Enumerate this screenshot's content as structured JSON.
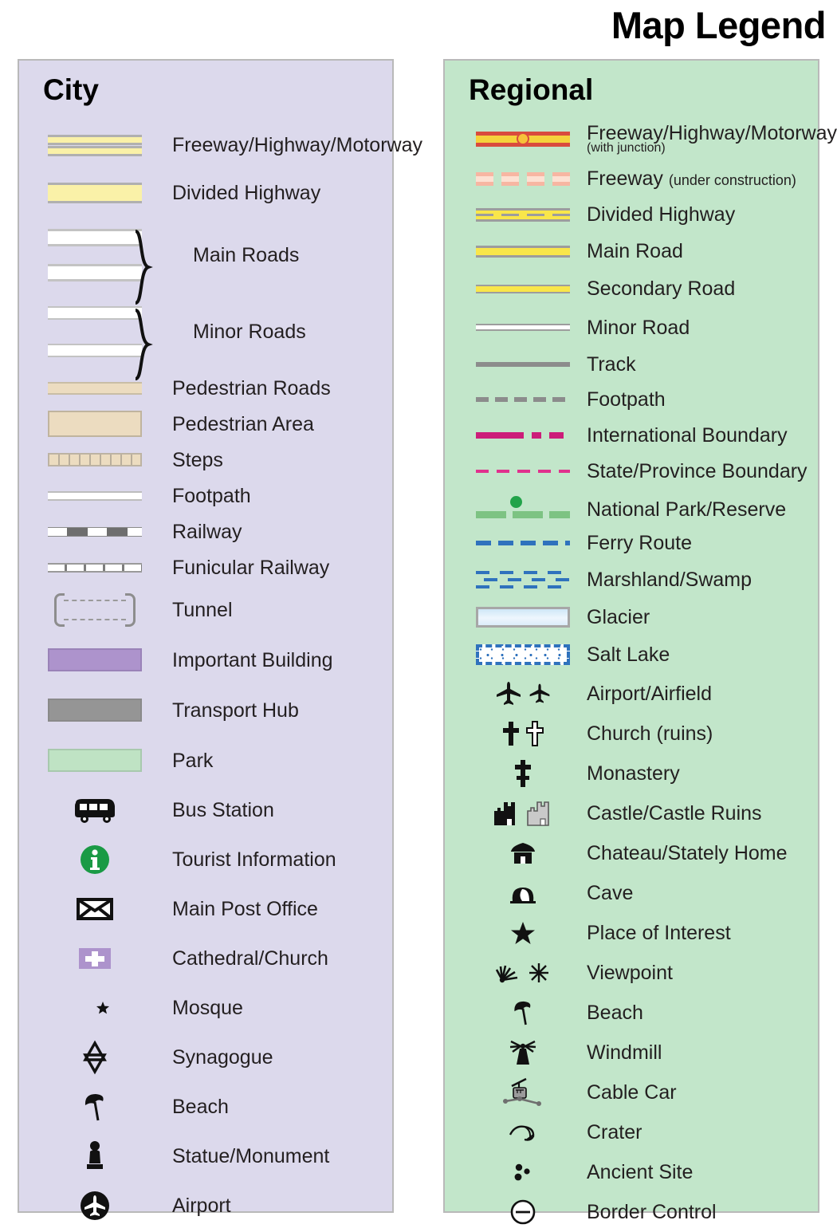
{
  "title": "Map Legend",
  "panels": {
    "city": {
      "heading": "City",
      "bg_color": "#dcd9ec",
      "items": [
        {
          "label": "Freeway/Highway/Motorway",
          "symbol": "freeway-double-band"
        },
        {
          "label": "Divided Highway",
          "symbol": "divided-highway-band"
        },
        {
          "label": "Main Roads",
          "symbol": "main-roads-pair-brace"
        },
        {
          "label": "Minor Roads",
          "symbol": "minor-roads-pair-brace"
        },
        {
          "label": "Pedestrian Roads",
          "symbol": "pedestrian-road-band"
        },
        {
          "label": "Pedestrian Area",
          "symbol": "pedestrian-area-block"
        },
        {
          "label": "Steps",
          "symbol": "steps-hatched-band"
        },
        {
          "label": "Footpath",
          "symbol": "footpath-thin-line"
        },
        {
          "label": "Railway",
          "symbol": "railway-dashed-line"
        },
        {
          "label": "Funicular Railway",
          "symbol": "funicular-ticked-line"
        },
        {
          "label": "Tunnel",
          "symbol": "tunnel-brackets"
        },
        {
          "label": "Important Building",
          "symbol": "important-building-block"
        },
        {
          "label": "Transport Hub",
          "symbol": "transport-hub-block"
        },
        {
          "label": "Park",
          "symbol": "park-block"
        },
        {
          "label": "Bus Station",
          "symbol": "bus-icon"
        },
        {
          "label": "Tourist Information",
          "symbol": "information-icon"
        },
        {
          "label": "Main Post Office",
          "symbol": "envelope-icon"
        },
        {
          "label": "Cathedral/Church",
          "symbol": "church-cross-icon"
        },
        {
          "label": "Mosque",
          "symbol": "crescent-star-icon"
        },
        {
          "label": "Synagogue",
          "symbol": "star-of-david-icon"
        },
        {
          "label": "Beach",
          "symbol": "beach-umbrella-icon"
        },
        {
          "label": "Statue/Monument",
          "symbol": "statue-icon"
        },
        {
          "label": "Airport",
          "symbol": "airport-circle-icon"
        }
      ]
    },
    "regional": {
      "heading": "Regional",
      "bg_color": "#c2e6ca",
      "items": [
        {
          "label": "Freeway/Highway/Motorway",
          "sublabel": "(with junction)",
          "sub_style": "block",
          "symbol": "freeway-junction-line"
        },
        {
          "label": "Freeway",
          "sublabel": "(under construction)",
          "sub_style": "inline",
          "symbol": "freeway-construction-dashes"
        },
        {
          "label": "Divided Highway",
          "symbol": "divided-highway-line"
        },
        {
          "label": "Main Road",
          "symbol": "main-road-line"
        },
        {
          "label": "Secondary Road",
          "symbol": "secondary-road-line"
        },
        {
          "label": "Minor Road",
          "symbol": "minor-road-line"
        },
        {
          "label": "Track",
          "symbol": "track-line"
        },
        {
          "label": "Footpath",
          "symbol": "footpath-dashed-line"
        },
        {
          "label": "International Boundary",
          "symbol": "international-boundary-line"
        },
        {
          "label": "State/Province Boundary",
          "symbol": "state-boundary-line"
        },
        {
          "label": "National Park/Reserve",
          "symbol": "national-park-line"
        },
        {
          "label": "Ferry Route",
          "symbol": "ferry-route-line"
        },
        {
          "label": "Marshland/Swamp",
          "symbol": "marshland-pattern"
        },
        {
          "label": "Glacier",
          "symbol": "glacier-block"
        },
        {
          "label": "Salt Lake",
          "symbol": "salt-lake-block"
        },
        {
          "label": "Airport/Airfield",
          "symbol": "airplane-pair-icon"
        },
        {
          "label": "Church (ruins)",
          "symbol": "cross-pair-icon"
        },
        {
          "label": "Monastery",
          "symbol": "monastery-cross-icon"
        },
        {
          "label": "Castle/Castle Ruins",
          "symbol": "castle-pair-icon"
        },
        {
          "label": "Chateau/Stately Home",
          "symbol": "chateau-icon"
        },
        {
          "label": "Cave",
          "symbol": "cave-icon"
        },
        {
          "label": "Place of Interest",
          "symbol": "star-icon"
        },
        {
          "label": "Viewpoint",
          "symbol": "viewpoint-pair-icon"
        },
        {
          "label": "Beach",
          "symbol": "beach-umbrella-icon"
        },
        {
          "label": "Windmill",
          "symbol": "windmill-icon"
        },
        {
          "label": "Cable Car",
          "symbol": "cable-car-icon"
        },
        {
          "label": "Crater",
          "symbol": "crater-icon"
        },
        {
          "label": "Ancient Site",
          "symbol": "ancient-site-icon"
        },
        {
          "label": "Border Control",
          "symbol": "border-control-icon"
        }
      ]
    }
  },
  "colors": {
    "city_panel_bg": "#dcd9ec",
    "regional_panel_bg": "#c2e6ca",
    "highway_yellow": "#faf1a8",
    "road_yellow": "#f9e64a",
    "freeway_red": "#d94b3e",
    "pedestrian_tan": "#ecdcc0",
    "important_building_purple": "#ad93cc",
    "transport_hub_gray": "#959595",
    "park_green": "#bfe3c4",
    "boundary_magenta": "#cc1d79",
    "state_boundary_pink": "#e0318d",
    "national_park_green": "#7dc383",
    "ferry_blue": "#2f72bd",
    "info_green": "#1a9a45"
  }
}
